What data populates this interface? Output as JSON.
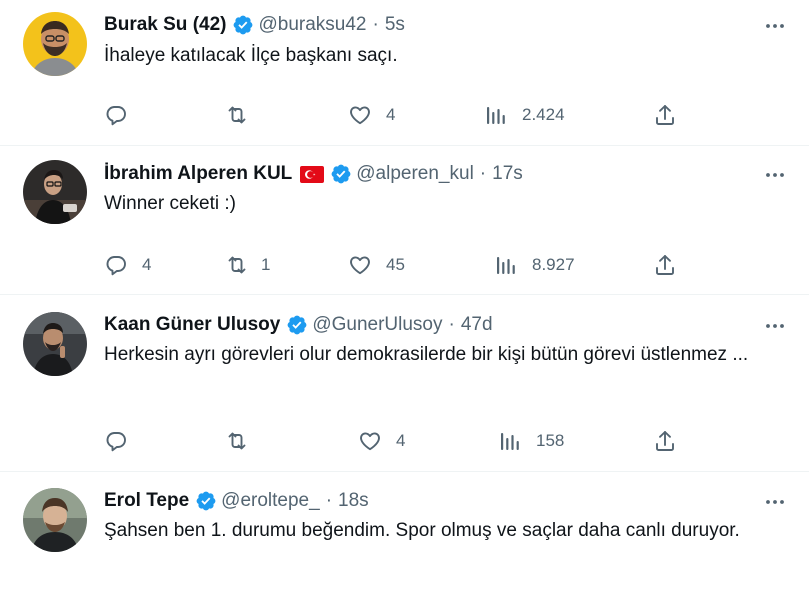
{
  "colors": {
    "verified": "#1d9bf0",
    "muted": "#536471",
    "text": "#0f1419",
    "divider": "#eff3f4"
  },
  "tweets": [
    {
      "name": "Burak Su (42)",
      "handle": "@buraksu42",
      "separator": "·",
      "time": "5s",
      "text": "İhaleye katılacak İlçe başkanı saçı.",
      "replies": "",
      "retweets": "",
      "likes": "4",
      "views": "2.424"
    },
    {
      "name": "İbrahim Alperen KUL",
      "flag": "turkey-flag",
      "handle": "@alperen_kul",
      "separator": "·",
      "time": "17s",
      "text": "Winner ceketi :)",
      "replies": "4",
      "retweets": "1",
      "likes": "45",
      "views": "8.927"
    },
    {
      "name": "Kaan Güner Ulusoy",
      "handle": "@GunerUlusoy",
      "separator": "·",
      "time": "47d",
      "text": "Herkesin ayrı görevleri olur demokrasilerde bir kişi bütün görevi üstlenmez ...",
      "replies": "",
      "retweets": "",
      "likes": "4",
      "views": "158"
    },
    {
      "name": "Erol Tepe",
      "handle": "@eroltepe_",
      "separator": "·",
      "time": "18s",
      "text": "Şahsen ben 1. durumu beğendim. Spor olmuş ve saçlar daha canlı duruyor."
    }
  ]
}
